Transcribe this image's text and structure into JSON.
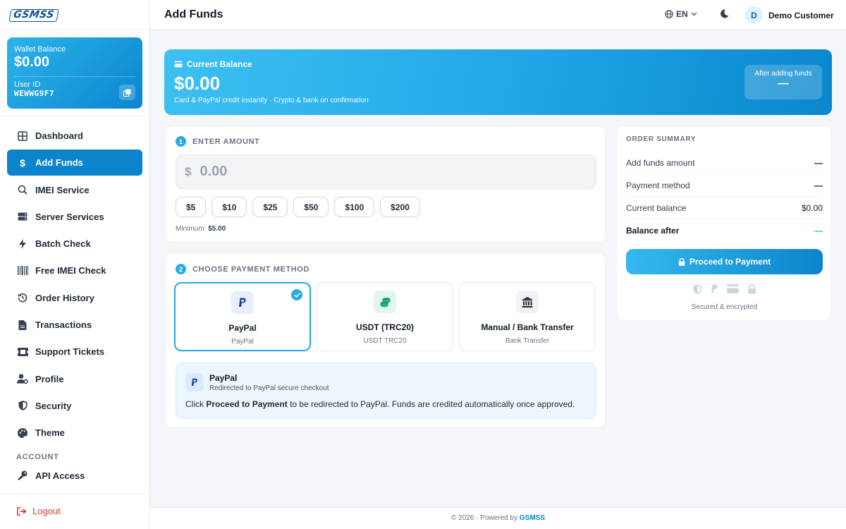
{
  "brand": {
    "logo_text": "GSMSS",
    "accent": "#0b84cc",
    "gradient_start": "#3ec0f1",
    "danger": "#e53935"
  },
  "wallet": {
    "balance_label": "Wallet Balance",
    "balance": "$0.00",
    "userid_label": "User ID",
    "userid": "WEWWG9F7",
    "copy_icon": "copy-icon"
  },
  "sidebar": {
    "items": [
      {
        "label": "Dashboard",
        "icon": "grid-icon"
      },
      {
        "label": "Add Funds",
        "icon": "dollar-icon",
        "active": true
      },
      {
        "label": "IMEI Service",
        "icon": "search-icon"
      },
      {
        "label": "Server Services",
        "icon": "server-icon"
      },
      {
        "label": "Batch Check",
        "icon": "bolt-icon"
      },
      {
        "label": "Free IMEI Check",
        "icon": "barcode-icon"
      },
      {
        "label": "Order History",
        "icon": "history-icon"
      },
      {
        "label": "Transactions",
        "icon": "file-icon"
      },
      {
        "label": "Support Tickets",
        "icon": "ticket-icon"
      },
      {
        "label": "Profile",
        "icon": "user-gear-icon"
      },
      {
        "label": "Security",
        "icon": "shield-icon"
      },
      {
        "label": "Theme",
        "icon": "palette-icon"
      }
    ],
    "section_account": "ACCOUNT",
    "account_items": [
      {
        "label": "API Access",
        "icon": "key-icon"
      }
    ],
    "logout": "Logout"
  },
  "header": {
    "title": "Add Funds",
    "language": "EN",
    "user_initial": "D",
    "user_name": "Demo Customer"
  },
  "banner": {
    "label": "Current Balance",
    "amount": "$0.00",
    "note": "Card & PayPal credit instantly · Crypto & bank on confirmation",
    "after_label": "After adding funds",
    "after_value": "—"
  },
  "amount_step": {
    "number": "1",
    "title": "ENTER AMOUNT",
    "currency": "$",
    "placeholder": "0.00",
    "presets": [
      "$5",
      "$10",
      "$25",
      "$50",
      "$100",
      "$200"
    ],
    "minimum_label": "Minimum:",
    "minimum_value": "$5.00"
  },
  "payment_step": {
    "number": "2",
    "title": "CHOOSE PAYMENT METHOD",
    "methods": [
      {
        "name": "PayPal",
        "sub": "PayPal",
        "icon": "paypal-icon",
        "selected": true
      },
      {
        "name": "USDT (TRC20)",
        "sub": "USDT TRC20",
        "icon": "coins-icon",
        "selected": false
      },
      {
        "name": "Manual / Bank Transfer",
        "sub": "Bank Transfer",
        "icon": "bank-icon",
        "selected": false
      }
    ],
    "info": {
      "title": "PayPal",
      "subtitle": "Redirected to PayPal secure checkout",
      "text_prefix": "Click",
      "text_bold": "Proceed to Payment",
      "text_suffix": "to be redirected to PayPal. Funds are credited automatically once approved."
    }
  },
  "summary": {
    "title": "ORDER SUMMARY",
    "rows": [
      {
        "label": "Add funds amount",
        "value": "—"
      },
      {
        "label": "Payment method",
        "value": "—"
      },
      {
        "label": "Current balance",
        "value": "$0.00"
      },
      {
        "label": "Balance after",
        "value": "—"
      }
    ],
    "button": "Proceed to Payment",
    "secure_text": "Secured & encrypted"
  },
  "footer": {
    "text": "© 2026 · Powered by",
    "brand": "GSMSS"
  }
}
